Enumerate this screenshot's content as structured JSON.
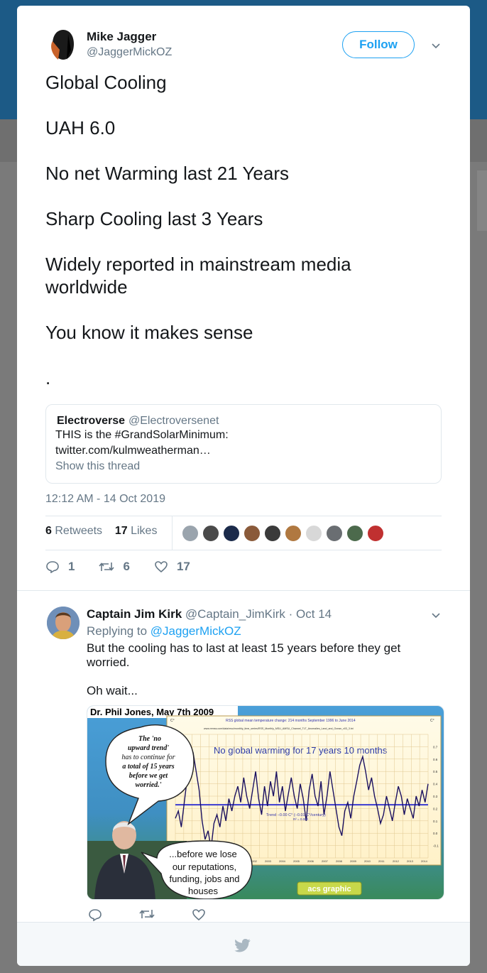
{
  "tweet": {
    "author_name": "Mike Jagger",
    "author_handle": "@JaggerMickOZ",
    "follow_label": "Follow",
    "lines": [
      "Global Cooling",
      "UAH 6.0",
      "No net Warming last 21 Years",
      "Sharp Cooling last 3 Years",
      "Widely reported in mainstream media worldwide",
      "You know it makes sense",
      "."
    ],
    "timestamp": "12:12 AM - 14 Oct 2019",
    "retweets_count": "6",
    "retweets_label": "Retweets",
    "likes_count": "17",
    "likes_label": "Likes",
    "reply_count": "1",
    "retweet_count": "6",
    "like_count": "17"
  },
  "quote": {
    "name": "Electroverse",
    "handle": "@Electroversenet",
    "line1": "THIS is the #GrandSolarMinimum:",
    "line2": "twitter.com/kulmweatherman…",
    "show_thread": "Show this thread"
  },
  "likers": [
    "#9aa4ad",
    "#4a4a4a",
    "#1b2a4a",
    "#8a5a3a",
    "#3a3a3a",
    "#b07840",
    "#d8d8d8",
    "#6a6e72",
    "#4c6a4c",
    "#c03030"
  ],
  "reply": {
    "name": "Captain Jim Kirk",
    "handle": "@Captain_JimKirk",
    "date": "· Oct 14",
    "replying_prefix": "Replying to",
    "replying_handle": "@JaggerMickOZ",
    "text1": "But the cooling has to last at least 15 years before they get worried.",
    "text2": "Oh wait..."
  },
  "image": {
    "header": "Dr. Phil Jones, May 7th 2009",
    "chart_title": "RSS global mean temperature change: 214 months September 1996 to June 2014",
    "chart_url": "www.remss.com/data/msu/monthly_time_series/RSS_Monthly_MSU_AMSU_Channel_TLT_Anomalies_Land_and_Ocean_v03_3.txt",
    "headline": "No global warming for 17 years 10 months",
    "trend_label": "Trend −0.00 C° (−0.01 C°/century)",
    "r2_label": "R² = 0.000",
    "bubble1": [
      "The 'no",
      "upward trend'",
      "has to continue for",
      "a total of 15 years",
      "before we get",
      "worried.'"
    ],
    "bubble2": [
      "...before we lose",
      "our reputations,",
      "funding, jobs and",
      "houses"
    ],
    "badge": "acs graphic",
    "x_ticks": [
      "2002",
      "2003",
      "2004",
      "2005",
      "2006",
      "2007",
      "2008",
      "2009",
      "2010",
      "2011",
      "2012",
      "2013",
      "2014"
    ],
    "y_ticks": [
      "0.7",
      "0.6",
      "0.5",
      "0.4",
      "0.3",
      "0.2",
      "0.1",
      "0.0",
      "-0.1"
    ]
  },
  "chart_data": {
    "type": "line",
    "title": "RSS global mean temperature change: 214 months September 1996 to June 2014",
    "xlabel": "",
    "ylabel": "C°",
    "ylim": [
      -0.2,
      0.8
    ],
    "trend_value": 0.23,
    "values": [
      0.12,
      0.18,
      0.05,
      0.25,
      0.45,
      0.72,
      0.65,
      0.5,
      0.35,
      0.1,
      -0.05,
      0.02,
      -0.12,
      0.08,
      0.15,
      0.05,
      0.22,
      0.1,
      0.28,
      0.18,
      0.3,
      0.38,
      0.25,
      0.45,
      0.3,
      0.2,
      0.35,
      0.5,
      0.28,
      0.15,
      0.38,
      0.22,
      0.42,
      0.3,
      0.5,
      0.25,
      0.38,
      0.18,
      0.32,
      0.45,
      0.3,
      0.2,
      0.4,
      0.28,
      0.1,
      0.35,
      0.48,
      0.3,
      0.22,
      0.42,
      0.15,
      0.3,
      0.5,
      0.35,
      0.2,
      0.05,
      -0.02,
      0.18,
      0.25,
      0.12,
      0.3,
      0.42,
      0.55,
      0.62,
      0.5,
      0.35,
      0.45,
      0.3,
      0.2,
      0.08,
      0.15,
      0.3,
      0.2,
      0.1,
      0.25,
      0.38,
      0.3,
      0.15,
      0.28,
      0.2,
      0.12,
      0.3,
      0.22,
      0.35,
      0.25,
      0.4
    ]
  }
}
